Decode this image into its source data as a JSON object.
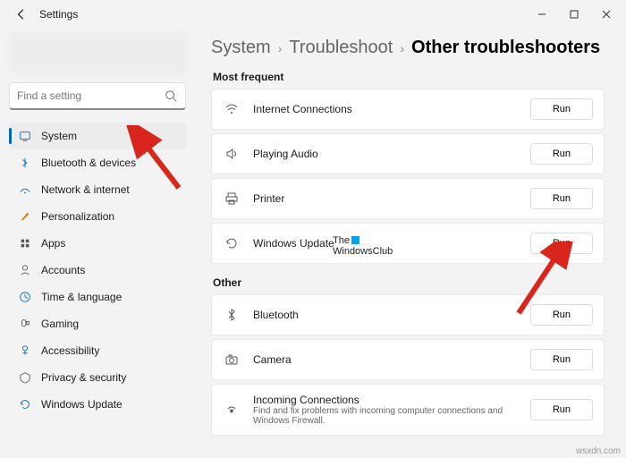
{
  "titlebar": {
    "title": "Settings"
  },
  "search": {
    "placeholder": "Find a setting"
  },
  "sidebar": {
    "items": [
      {
        "label": "System",
        "active": true
      },
      {
        "label": "Bluetooth & devices"
      },
      {
        "label": "Network & internet"
      },
      {
        "label": "Personalization"
      },
      {
        "label": "Apps"
      },
      {
        "label": "Accounts"
      },
      {
        "label": "Time & language"
      },
      {
        "label": "Gaming"
      },
      {
        "label": "Accessibility"
      },
      {
        "label": "Privacy & security"
      },
      {
        "label": "Windows Update"
      }
    ]
  },
  "breadcrumb": {
    "a": "System",
    "b": "Troubleshoot",
    "c": "Other troubleshooters"
  },
  "sections": {
    "most_frequent": {
      "title": "Most frequent",
      "items": [
        {
          "label": "Internet Connections",
          "run": "Run"
        },
        {
          "label": "Playing Audio",
          "run": "Run"
        },
        {
          "label": "Printer",
          "run": "Run"
        },
        {
          "label": "Windows Update",
          "run": "Run"
        }
      ]
    },
    "other": {
      "title": "Other",
      "items": [
        {
          "label": "Bluetooth",
          "run": "Run"
        },
        {
          "label": "Camera",
          "run": "Run"
        },
        {
          "label": "Incoming Connections",
          "sub": "Find and fix problems with incoming computer connections and Windows Firewall.",
          "run": "Run"
        }
      ]
    }
  },
  "watermark": {
    "line1": "The",
    "line2": "WindowsClub"
  },
  "footer": "wsxdn.com"
}
